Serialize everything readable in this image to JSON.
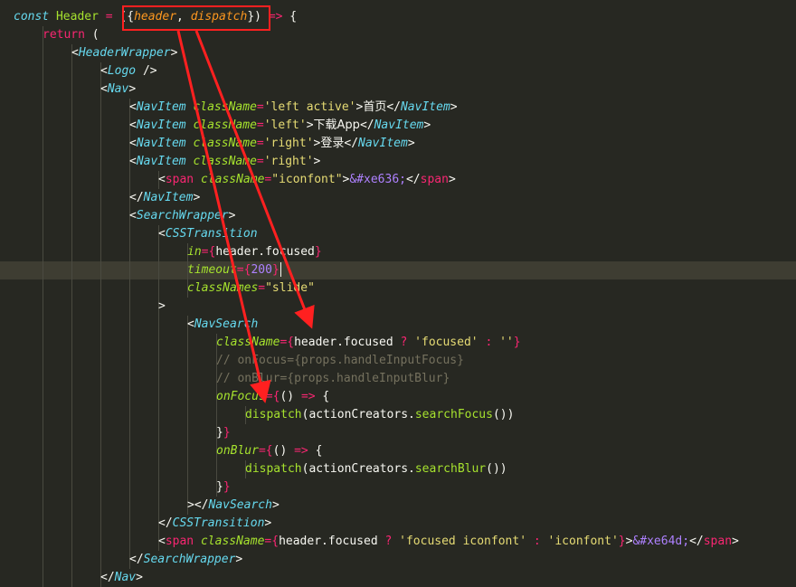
{
  "theme": {
    "background": "#272822",
    "current_line": "#3e3d32",
    "annotation": "#ff2020"
  },
  "highlight": {
    "box_text": "({header, dispatch})"
  },
  "lines": [
    {
      "indent": 0,
      "tokens": [
        [
          "kw",
          "const "
        ],
        [
          "var",
          "Header"
        ],
        [
          "p",
          " "
        ],
        [
          "op",
          "="
        ],
        [
          "p",
          " ({"
        ],
        [
          "param",
          "header"
        ],
        [
          "p",
          ", "
        ],
        [
          "param",
          "dispatch"
        ],
        [
          "p",
          "}) "
        ],
        [
          "op",
          "=>"
        ],
        [
          "p",
          " {"
        ]
      ]
    },
    {
      "indent": 1,
      "tokens": [
        [
          "ret",
          "return"
        ],
        [
          "p",
          " ("
        ]
      ]
    },
    {
      "indent": 2,
      "tokens": [
        [
          "p",
          "<"
        ],
        [
          "tag",
          "HeaderWrapper"
        ],
        [
          "p",
          ">"
        ]
      ]
    },
    {
      "indent": 3,
      "tokens": [
        [
          "p",
          "<"
        ],
        [
          "tag",
          "Logo"
        ],
        [
          "p",
          " />"
        ]
      ]
    },
    {
      "indent": 3,
      "tokens": [
        [
          "p",
          "<"
        ],
        [
          "tag",
          "Nav"
        ],
        [
          "p",
          ">"
        ]
      ]
    },
    {
      "indent": 4,
      "tokens": [
        [
          "p",
          "<"
        ],
        [
          "tag",
          "NavItem"
        ],
        [
          "p",
          " "
        ],
        [
          "attr",
          "className"
        ],
        [
          "op",
          "="
        ],
        [
          "str",
          "'left active'"
        ],
        [
          "p",
          ">"
        ],
        [
          "cjk",
          "首页"
        ],
        [
          "p",
          "</"
        ],
        [
          "tag",
          "NavItem"
        ],
        [
          "p",
          ">"
        ]
      ]
    },
    {
      "indent": 4,
      "tokens": [
        [
          "p",
          "<"
        ],
        [
          "tag",
          "NavItem"
        ],
        [
          "p",
          " "
        ],
        [
          "attr",
          "className"
        ],
        [
          "op",
          "="
        ],
        [
          "str",
          "'left'"
        ],
        [
          "p",
          ">"
        ],
        [
          "cjk",
          "下载App"
        ],
        [
          "p",
          "</"
        ],
        [
          "tag",
          "NavItem"
        ],
        [
          "p",
          ">"
        ]
      ]
    },
    {
      "indent": 4,
      "tokens": [
        [
          "p",
          "<"
        ],
        [
          "tag",
          "NavItem"
        ],
        [
          "p",
          " "
        ],
        [
          "attr",
          "className"
        ],
        [
          "op",
          "="
        ],
        [
          "str",
          "'right'"
        ],
        [
          "p",
          ">"
        ],
        [
          "cjk",
          "登录"
        ],
        [
          "p",
          "</"
        ],
        [
          "tag",
          "NavItem"
        ],
        [
          "p",
          ">"
        ]
      ]
    },
    {
      "indent": 4,
      "tokens": [
        [
          "p",
          "<"
        ],
        [
          "tag",
          "NavItem"
        ],
        [
          "p",
          " "
        ],
        [
          "attr",
          "className"
        ],
        [
          "op",
          "="
        ],
        [
          "str",
          "'right'"
        ],
        [
          "p",
          ">"
        ]
      ]
    },
    {
      "indent": 5,
      "tokens": [
        [
          "p",
          "<"
        ],
        [
          "html",
          "span"
        ],
        [
          "p",
          " "
        ],
        [
          "attr",
          "className"
        ],
        [
          "op",
          "="
        ],
        [
          "str",
          "\"iconfont\""
        ],
        [
          "p",
          ">"
        ],
        [
          "ent",
          "&#xe636;"
        ],
        [
          "p",
          "</"
        ],
        [
          "html",
          "span"
        ],
        [
          "p",
          ">"
        ]
      ]
    },
    {
      "indent": 4,
      "tokens": [
        [
          "p",
          "</"
        ],
        [
          "tag",
          "NavItem"
        ],
        [
          "p",
          ">"
        ]
      ]
    },
    {
      "indent": 4,
      "tokens": [
        [
          "p",
          "<"
        ],
        [
          "tag",
          "SearchWrapper"
        ],
        [
          "p",
          ">"
        ]
      ]
    },
    {
      "indent": 5,
      "tokens": [
        [
          "p",
          "<"
        ],
        [
          "tag",
          "CSSTransition"
        ]
      ]
    },
    {
      "indent": 6,
      "tokens": [
        [
          "attr",
          "in"
        ],
        [
          "op",
          "="
        ],
        [
          "br",
          "{"
        ],
        [
          "p",
          "header.focused"
        ],
        [
          "br",
          "}"
        ]
      ]
    },
    {
      "indent": 6,
      "tokens": [
        [
          "attr",
          "timeout"
        ],
        [
          "op",
          "="
        ],
        [
          "br",
          "{"
        ],
        [
          "num",
          "200"
        ],
        [
          "br",
          "}"
        ]
      ],
      "current": true
    },
    {
      "indent": 6,
      "tokens": [
        [
          "attr",
          "classNames"
        ],
        [
          "op",
          "="
        ],
        [
          "str",
          "\"slide\""
        ]
      ]
    },
    {
      "indent": 5,
      "tokens": [
        [
          "p",
          ">"
        ]
      ]
    },
    {
      "indent": 6,
      "tokens": [
        [
          "p",
          "<"
        ],
        [
          "tag",
          "NavSearch"
        ]
      ]
    },
    {
      "indent": 7,
      "tokens": [
        [
          "attr",
          "className"
        ],
        [
          "op",
          "="
        ],
        [
          "br",
          "{"
        ],
        [
          "p",
          "header.focused "
        ],
        [
          "op",
          "?"
        ],
        [
          "p",
          " "
        ],
        [
          "str",
          "'focused'"
        ],
        [
          "p",
          " "
        ],
        [
          "op",
          ":"
        ],
        [
          "p",
          " "
        ],
        [
          "str",
          "''"
        ],
        [
          "br",
          "}"
        ]
      ]
    },
    {
      "indent": 7,
      "tokens": [
        [
          "com",
          "// onFocus={props.handleInputFocus}"
        ]
      ]
    },
    {
      "indent": 7,
      "tokens": [
        [
          "com",
          "// onBlur={props.handleInputBlur}"
        ]
      ]
    },
    {
      "indent": 7,
      "tokens": [
        [
          "attr",
          "onFocus"
        ],
        [
          "op",
          "="
        ],
        [
          "br",
          "{"
        ],
        [
          "p",
          "() "
        ],
        [
          "op",
          "=>"
        ],
        [
          "p",
          " {"
        ]
      ]
    },
    {
      "indent": 8,
      "tokens": [
        [
          "fn",
          "dispatch"
        ],
        [
          "p",
          "(actionCreators."
        ],
        [
          "fn",
          "searchFocus"
        ],
        [
          "p",
          "())"
        ]
      ]
    },
    {
      "indent": 7,
      "tokens": [
        [
          "p",
          "}"
        ],
        [
          "br",
          "}"
        ]
      ]
    },
    {
      "indent": 7,
      "tokens": [
        [
          "attr",
          "onBlur"
        ],
        [
          "op",
          "="
        ],
        [
          "br",
          "{"
        ],
        [
          "p",
          "() "
        ],
        [
          "op",
          "=>"
        ],
        [
          "p",
          " {"
        ]
      ]
    },
    {
      "indent": 8,
      "tokens": [
        [
          "fn",
          "dispatch"
        ],
        [
          "p",
          "(actionCreators."
        ],
        [
          "fn",
          "searchBlur"
        ],
        [
          "p",
          "())"
        ]
      ]
    },
    {
      "indent": 7,
      "tokens": [
        [
          "p",
          "}"
        ],
        [
          "br",
          "}"
        ]
      ]
    },
    {
      "indent": 6,
      "tokens": [
        [
          "p",
          "></"
        ],
        [
          "tag",
          "NavSearch"
        ],
        [
          "p",
          ">"
        ]
      ]
    },
    {
      "indent": 5,
      "tokens": [
        [
          "p",
          "</"
        ],
        [
          "tag",
          "CSSTransition"
        ],
        [
          "p",
          ">"
        ]
      ]
    },
    {
      "indent": 5,
      "tokens": [
        [
          "p",
          "<"
        ],
        [
          "html",
          "span"
        ],
        [
          "p",
          " "
        ],
        [
          "attr",
          "className"
        ],
        [
          "op",
          "="
        ],
        [
          "br",
          "{"
        ],
        [
          "p",
          "header.focused "
        ],
        [
          "op",
          "?"
        ],
        [
          "p",
          " "
        ],
        [
          "str",
          "'focused iconfont'"
        ],
        [
          "p",
          " "
        ],
        [
          "op",
          ":"
        ],
        [
          "p",
          " "
        ],
        [
          "str",
          "'iconfont'"
        ],
        [
          "br",
          "}"
        ],
        [
          "p",
          ">"
        ],
        [
          "ent",
          "&#xe64d;"
        ],
        [
          "p",
          "</"
        ],
        [
          "html",
          "span"
        ],
        [
          "p",
          ">"
        ]
      ]
    },
    {
      "indent": 4,
      "tokens": [
        [
          "p",
          "</"
        ],
        [
          "tag",
          "SearchWrapper"
        ],
        [
          "p",
          ">"
        ]
      ]
    },
    {
      "indent": 3,
      "tokens": [
        [
          "p",
          "</"
        ],
        [
          "tag",
          "Nav"
        ],
        [
          "p",
          ">"
        ]
      ]
    }
  ]
}
